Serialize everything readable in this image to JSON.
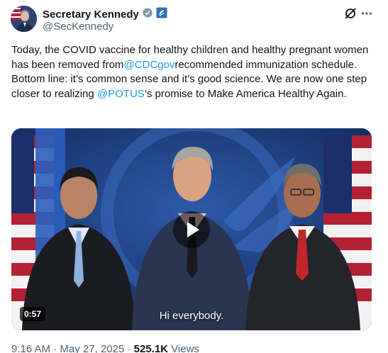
{
  "author": {
    "display_name": "Secretary Kennedy",
    "handle": "@SecKennedy",
    "avatar_icon": "avatar-photo",
    "verified_icon": "verified-badge-icon",
    "affiliate_icon": "hhs-affiliate-icon"
  },
  "header_actions": {
    "grok_icon": "grok-icon",
    "more_icon": "more-icon"
  },
  "tweet": {
    "part1": "Today, the COVID vaccine for healthy children and healthy pregnant women has been removed from",
    "mention1": "@CDCgov",
    "part2": "recommended immunization schedule. Bottom line: it’s common sense and it’s good science. We are now one step closer to realizing",
    "mention2": "@POTUS",
    "part3": "’s promise to Make America Healthy Again."
  },
  "video": {
    "duration": "0:57",
    "caption": "Hi everybody.",
    "play_icon": "play-icon"
  },
  "meta": {
    "time": "9:16 AM",
    "separator": "·",
    "date": "May 27, 2025",
    "views_count": "525.1K",
    "views_label": "Views"
  },
  "colors": {
    "link": "#1d9bf0",
    "verified": "#829aab",
    "text": "#0f1419",
    "secondary": "#536471"
  }
}
